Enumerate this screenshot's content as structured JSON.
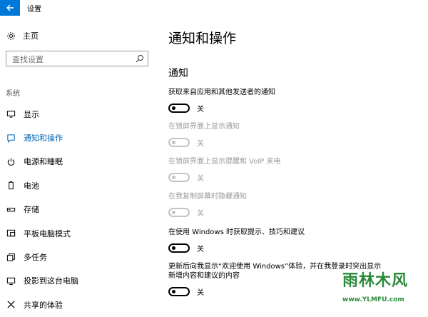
{
  "window": {
    "title": "设置"
  },
  "sidebar": {
    "home_label": "主页",
    "search_placeholder": "查找设置",
    "section_label": "系统",
    "items": [
      {
        "label": "显示",
        "icon": "monitor-icon"
      },
      {
        "label": "通知和操作",
        "icon": "notification-icon",
        "active": true
      },
      {
        "label": "电源和睡眠",
        "icon": "power-icon"
      },
      {
        "label": "电池",
        "icon": "battery-icon"
      },
      {
        "label": "存储",
        "icon": "storage-icon"
      },
      {
        "label": "平板电脑模式",
        "icon": "tablet-icon"
      },
      {
        "label": "多任务",
        "icon": "multitask-icon"
      },
      {
        "label": "投影到这台电脑",
        "icon": "project-icon"
      },
      {
        "label": "共享的体验",
        "icon": "share-icon"
      }
    ]
  },
  "main": {
    "page_title": "通知和操作",
    "group_title": "通知",
    "settings": [
      {
        "label": "获取来自应用和其他发送者的通知",
        "state": "关",
        "enabled": true
      },
      {
        "label": "在锁屏界面上显示通知",
        "state": "关",
        "enabled": false
      },
      {
        "label": "在锁屏界面上显示提醒和 VoIP 来电",
        "state": "关",
        "enabled": false
      },
      {
        "label": "在我复制屏幕时隐藏通知",
        "state": "关",
        "enabled": false
      },
      {
        "label": "在使用 Windows 时获取提示、技巧和建议",
        "state": "关",
        "enabled": true
      },
      {
        "label_line1": "更新后向我显示“欢迎使用 Windows”体验，并在我登录时突出显示",
        "label_line2": "新增内容和建议的内容",
        "state": "关",
        "enabled": true
      }
    ]
  },
  "watermark": {
    "brand": "雨林木风",
    "url": "www.YLMFU.com"
  },
  "colors": {
    "accent": "#0078d7",
    "active_text": "#0063b1",
    "disabled_text": "#9a9a9a"
  }
}
